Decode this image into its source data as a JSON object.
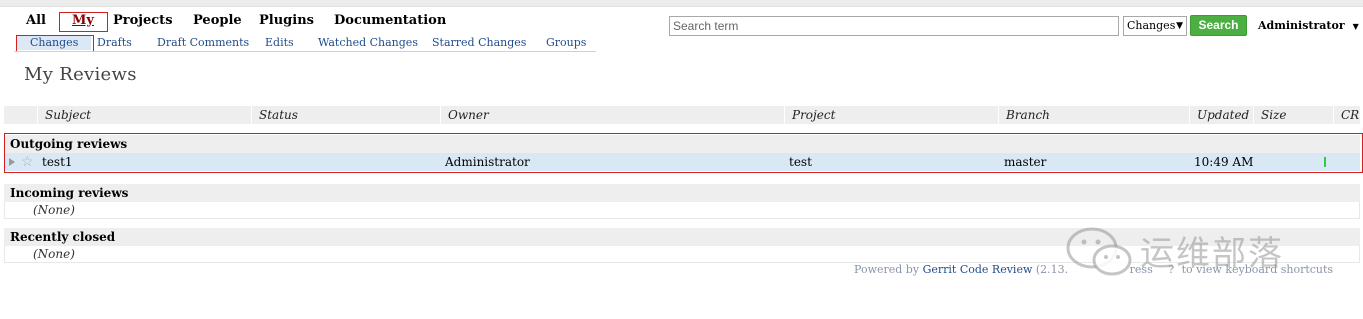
{
  "top_menu": {
    "items": [
      {
        "label": "All",
        "active": false
      },
      {
        "label": "My",
        "active": true
      },
      {
        "label": "Projects",
        "active": false
      },
      {
        "label": "People",
        "active": false
      },
      {
        "label": "Plugins",
        "active": false
      },
      {
        "label": "Documentation",
        "active": false
      }
    ]
  },
  "sub_menu": {
    "items": [
      {
        "label": "Changes",
        "active": true
      },
      {
        "label": "Drafts",
        "active": false
      },
      {
        "label": "Draft Comments",
        "active": false
      },
      {
        "label": "Edits",
        "active": false
      },
      {
        "label": "Watched Changes",
        "active": false
      },
      {
        "label": "Starred Changes",
        "active": false
      },
      {
        "label": "Groups",
        "active": false
      }
    ]
  },
  "page_title": "My Reviews",
  "search": {
    "placeholder": "Search term",
    "type_value": "Changes",
    "button_label": "Search"
  },
  "user": {
    "name": "Administrator"
  },
  "table": {
    "columns": [
      "Subject",
      "Status",
      "Owner",
      "Project",
      "Branch",
      "Updated",
      "Size",
      "CR"
    ],
    "sections": [
      {
        "title": "Outgoing reviews",
        "rows": [
          {
            "subject": "test1",
            "status": "",
            "owner": "Administrator",
            "project": "test",
            "branch": "master",
            "updated": "10:49 AM",
            "size": ""
          }
        ]
      },
      {
        "title": "Incoming reviews",
        "empty_text": "(None)"
      },
      {
        "title": "Recently closed",
        "empty_text": "(None)"
      }
    ]
  },
  "footer": {
    "prefix": "Powered by",
    "link": "Gerrit Code Review",
    "version": "(2.13.",
    "hint_press": "ress",
    "hint_key": "?",
    "hint_suffix": "to view keyboard shortcuts"
  },
  "watermark": {
    "text": "运维部落"
  },
  "colors": {
    "accent_red": "#d21f1f",
    "search_button": "#4caf42",
    "link": "#1f4d8c",
    "selected_row": "#d9e8f5",
    "cr_bar": "#2ecc40"
  }
}
